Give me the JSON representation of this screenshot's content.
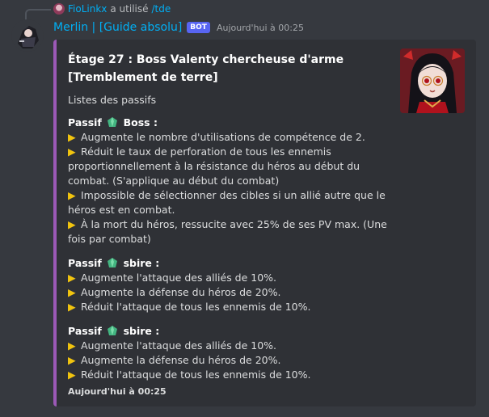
{
  "reply": {
    "user": "FioLinkx",
    "action": "a utilisé",
    "command": "/tde"
  },
  "message": {
    "author": "Merlin | [Guide absolu]",
    "bot_tag": "BOT",
    "timestamp": "Aujourd'hui à 00:25"
  },
  "embed": {
    "accent_color": "#9b59b6",
    "title": "Étage 27 : Boss Valenty chercheuse d'arme [Tremblement de terre]",
    "intro": "Listes des passifs",
    "sections": [
      {
        "prefix": "Passif",
        "icon": "green-gem-icon",
        "name": "Boss :",
        "lines": [
          "Augmente le nombre d'utilisations de compétence de 2.",
          "Réduit le taux de perforation de tous les ennemis proportionnellement à la résistance du héros au début du combat. (S'applique au début du combat)",
          "Impossible de sélectionner des cibles si un allié autre que le héros est en combat.",
          "À la mort du héros, ressucite avec 25% de ses PV max. (Une fois par combat)"
        ]
      },
      {
        "prefix": "Passif",
        "icon": "green-gem-icon",
        "name": "sbire :",
        "lines": [
          "Augmente l'attaque des alliés de 10%.",
          "Augmente la défense du héros de 20%.",
          "Réduit l'attaque de tous les ennemis de 10%."
        ]
      },
      {
        "prefix": "Passif",
        "icon": "green-gem-icon",
        "name": "sbire :",
        "lines": [
          "Augmente l'attaque des alliés de 10%.",
          "Augmente la défense du héros de 20%.",
          "Réduit l'attaque de tous les ennemis de 10%."
        ]
      }
    ],
    "footer": "Aujourd'hui à 00:25"
  }
}
